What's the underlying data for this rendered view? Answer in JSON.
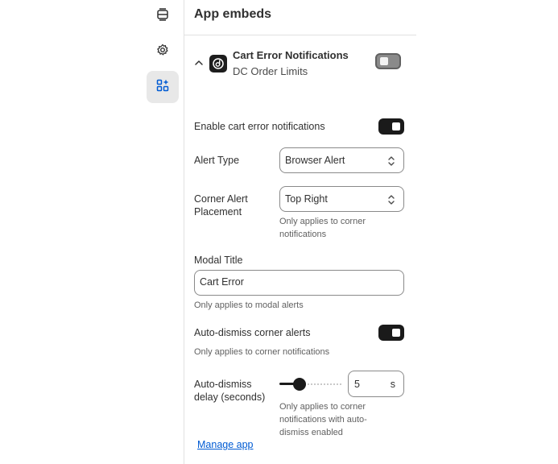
{
  "panel": {
    "title": "App embeds"
  },
  "embed": {
    "name": "Cart Error Notifications",
    "app": "DC Order Limits",
    "enabled": false
  },
  "settings": {
    "enable_label": "Enable cart error notifications",
    "enable_on": true,
    "alert_type_label": "Alert Type",
    "alert_type_value": "Browser Alert",
    "placement_label_1": "Corner Alert",
    "placement_label_2": "Placement",
    "placement_value": "Top Right",
    "placement_help_1": "Only applies to corner",
    "placement_help_2": "notifications",
    "modal_title_label": "Modal Title",
    "modal_title_value": "Cart Error",
    "modal_title_help": "Only applies to modal alerts",
    "auto_dismiss_label": "Auto-dismiss corner alerts",
    "auto_dismiss_on": true,
    "auto_dismiss_help": "Only applies to corner notifications",
    "delay_label_1": "Auto-dismiss",
    "delay_label_2": "delay (seconds)",
    "delay_value": "5",
    "delay_slider_fraction": 0.28,
    "delay_suffix": "s",
    "delay_help_1": "Only applies to corner",
    "delay_help_2": "notifications with auto-",
    "delay_help_3": "dismiss enabled"
  },
  "footer": {
    "manage_link": "Manage app"
  },
  "icons": {
    "rail": [
      "sections-icon",
      "settings-gear-icon",
      "app-embeds-icon"
    ],
    "app_logo": "dc-order-limits-logo"
  },
  "colors": {
    "toggle_on": "#1a1a1a",
    "toggle_off": "#8a8a8a",
    "link": "#005bd3",
    "active_rail": "#e8e8e8"
  }
}
